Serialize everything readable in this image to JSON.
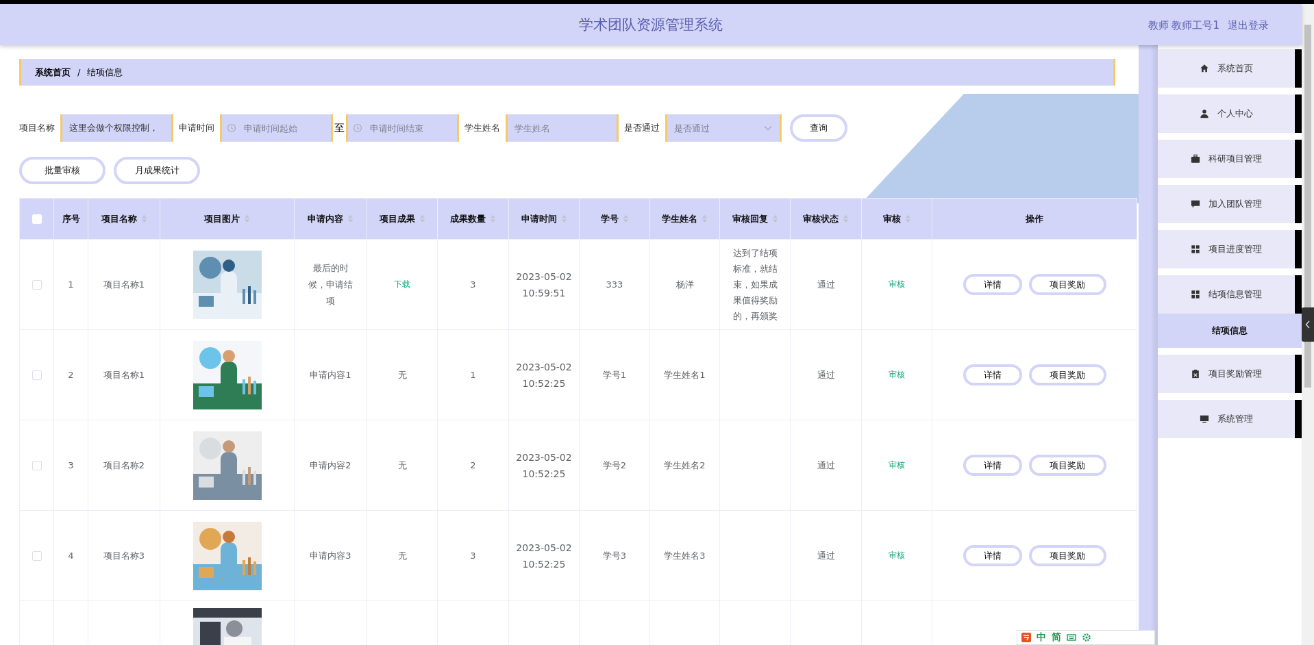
{
  "header": {
    "title": "学术团队资源管理系统",
    "user": "教师 教师工号1",
    "logout": "退出登录"
  },
  "breadcrumb": [
    "系统首页",
    "/",
    "结项信息"
  ],
  "filters": [
    {
      "kind": "text",
      "label": "项目名称",
      "value": "这里会做个权限控制，"
    },
    {
      "kind": "date",
      "label": "申请时间",
      "placeholder": "申请时间起始"
    },
    {
      "kind": "separator",
      "label": "至"
    },
    {
      "kind": "date",
      "placeholder": "申请时间结束"
    },
    {
      "kind": "text",
      "label": "学生姓名",
      "placeholder": "学生姓名"
    },
    {
      "kind": "select",
      "label": "是否通过",
      "placeholder": "是否通过"
    }
  ],
  "search_button": "查询",
  "actions": [
    "批量审核",
    "月成果统计"
  ],
  "table": {
    "header_checkbox": {
      "checked": false
    },
    "columns": [
      {
        "label": "序号",
        "sortable": false
      },
      {
        "label": "项目名称",
        "sortable": true
      },
      {
        "label": "项目图片",
        "sortable": true
      },
      {
        "label": "申请内容",
        "sortable": true
      },
      {
        "label": "项目成果",
        "sortable": true
      },
      {
        "label": "成果数量",
        "sortable": true
      },
      {
        "label": "申请时间",
        "sortable": true
      },
      {
        "label": "学号",
        "sortable": true
      },
      {
        "label": "学生姓名",
        "sortable": true
      },
      {
        "label": "审核回复",
        "sortable": true
      },
      {
        "label": "审核状态",
        "sortable": true
      },
      {
        "label": "审核",
        "sortable": true
      },
      {
        "label": "操作",
        "sortable": false
      }
    ],
    "rows": [
      {
        "checked": false,
        "index": "1",
        "name": "项目名称1",
        "image": {
          "kind": "picture"
        },
        "content": "最后的时候，申请结项",
        "result": {
          "kind": "link",
          "text": "下载"
        },
        "count": "3",
        "time": "2023-05-02 10:59:51",
        "student_id": "333",
        "student": "杨洋",
        "reply": "达到了结项标准，就结束，如果成果值得奖励的，再颁奖",
        "status": "通过",
        "review": "审核",
        "buttons": [
          "详情",
          "项目奖励"
        ]
      },
      {
        "checked": false,
        "index": "2",
        "name": "项目名称1",
        "image": {
          "kind": "picture"
        },
        "content": "申请内容1",
        "result": {
          "kind": "text",
          "text": "无"
        },
        "count": "1",
        "time": "2023-05-02 10:52:25",
        "student_id": "学号1",
        "student": "学生姓名1",
        "status": "通过",
        "review": "审核",
        "buttons": [
          "详情",
          "项目奖励"
        ]
      },
      {
        "checked": false,
        "index": "3",
        "name": "项目名称2",
        "image": {
          "kind": "picture"
        },
        "content": "申请内容2",
        "result": {
          "kind": "text",
          "text": "无"
        },
        "count": "2",
        "time": "2023-05-02 10:52:25",
        "student_id": "学号2",
        "student": "学生姓名2",
        "status": "通过",
        "review": "审核",
        "buttons": [
          "详情",
          "项目奖励"
        ]
      },
      {
        "checked": false,
        "index": "4",
        "name": "项目名称3",
        "image": {
          "kind": "picture"
        },
        "content": "申请内容3",
        "result": {
          "kind": "text",
          "text": "无"
        },
        "count": "3",
        "time": "2023-05-02 10:52:25",
        "student_id": "学号3",
        "student": "学生姓名3",
        "status": "通过",
        "review": "审核",
        "buttons": [
          "详情",
          "项目奖励"
        ]
      }
    ],
    "partial_row": {
      "image": {
        "kind": "picture"
      }
    }
  },
  "sidebar": {
    "items": [
      {
        "label": "系统首页",
        "selected": false
      },
      {
        "label": "个人中心",
        "selected": false
      },
      {
        "label": "科研项目管理",
        "selected": false
      },
      {
        "label": "加入团队管理",
        "selected": false
      },
      {
        "label": "项目进度管理",
        "selected": false
      },
      {
        "label": "结项信息管理",
        "selected": false,
        "children": [
          {
            "label": "结项信息",
            "selected": true
          }
        ]
      },
      {
        "label": "项目奖励管理",
        "selected": false
      },
      {
        "label": "系统管理",
        "selected": false
      }
    ]
  },
  "ime_bar": {
    "items": [
      "中",
      "简"
    ]
  }
}
